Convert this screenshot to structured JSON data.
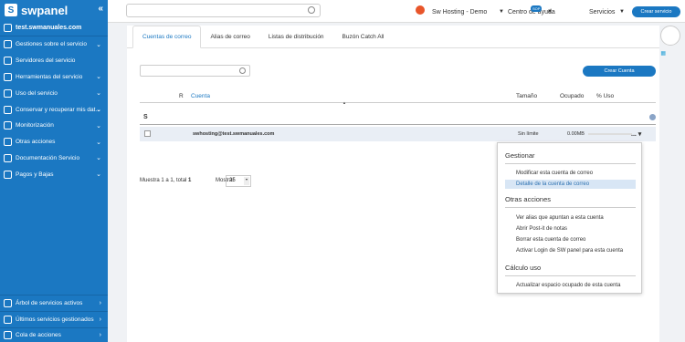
{
  "sidebar": {
    "logo": "swpanel",
    "account": "test.swmanuales.com",
    "items": [
      {
        "label": "Gestiones sobre el servicio",
        "chevron": "v"
      },
      {
        "label": "Servidores del servicio",
        "chevron": ""
      },
      {
        "label": "Herramientas del servicio",
        "chevron": "v"
      },
      {
        "label": "Uso del servicio",
        "chevron": "v"
      },
      {
        "label": "Conservar y recuperar mis dat...",
        "chevron": "v"
      },
      {
        "label": "Monitorización",
        "chevron": "v"
      },
      {
        "label": "Otras acciones",
        "chevron": "v"
      },
      {
        "label": "Documentación Servicio",
        "chevron": "v"
      },
      {
        "label": "Pagos y Bajas",
        "chevron": "v"
      }
    ],
    "bottom": [
      {
        "label": "Árbol de servicios activos",
        "chevron": ">"
      },
      {
        "label": "Últimos servicios gestionados",
        "chevron": ">"
      },
      {
        "label": "Cola de acciones",
        "chevron": ">"
      }
    ]
  },
  "topbar": {
    "brand": "Sw Hosting - Demo",
    "help": "Centro de ayuda",
    "help_badge": "SOP",
    "services": "Servicios",
    "new_service": "Crear servicio"
  },
  "tabs": [
    "Cuentas de correo",
    "Alias de correo",
    "Listas de distribución",
    "Buzón Catch All"
  ],
  "toolbar": {
    "create_account": "Crear Cuenta"
  },
  "table": {
    "headers": {
      "r": "R",
      "account": "Cuenta",
      "size": "Tamaño",
      "used": "Ocupado",
      "percent": "% Uso"
    },
    "group": "S",
    "rows": [
      {
        "email": "swhosting@test.swmanuales.com",
        "size": "Sin límite",
        "used": "0.00MB",
        "menu": "..."
      }
    ]
  },
  "pagination": {
    "summary_prefix": "Muestra 1 a 1, total",
    "summary_total": "1",
    "show_label": "Mostrar",
    "page_size": "25"
  },
  "dropdown": {
    "sections": [
      {
        "title": "Gestionar",
        "items": [
          "Modificar esta cuenta de correo",
          "Detalle de la cuenta de correo"
        ]
      },
      {
        "title": "Otras acciones",
        "items": [
          "Ver alias que apuntan a esta cuenta",
          "Abrir Post-it de notas",
          "Borrar esta cuenta de correo",
          "Activar Login de SW panel para esta cuenta"
        ]
      },
      {
        "title": "Cálculo uso",
        "items": [
          "Actualizar espacio ocupado de esta cuenta"
        ]
      }
    ],
    "highlighted": "Detalle de la cuenta de correo"
  },
  "colors": {
    "primary": "#1b78c2",
    "brand_dot": "#e8552a",
    "highlight": "#d8e6f5"
  }
}
